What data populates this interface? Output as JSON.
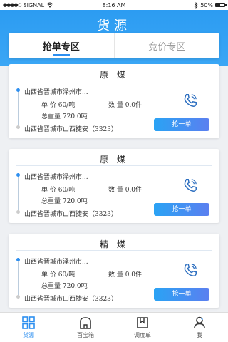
{
  "status_bar": {
    "carrier": "SIGNAL",
    "time": "8:16 AM",
    "battery": "50%"
  },
  "header": {
    "title": "货源"
  },
  "tabs": [
    {
      "label": "抢单专区",
      "active": true
    },
    {
      "label": "竞价专区",
      "active": false
    }
  ],
  "cards": [
    {
      "name": "原 煤",
      "origin": "山西省晋城市泽州市...",
      "unit_price": "单 价 60/吨",
      "quantity": "数 量 0.0件",
      "total_weight": "总重量 720.0吨",
      "destination": "山西省晋城市山西捷安（3323）",
      "button": "抢一单"
    },
    {
      "name": "原 煤",
      "origin": "山西省晋城市泽州市...",
      "unit_price": "单 价 60/吨",
      "quantity": "数 量 0.0件",
      "total_weight": "总重量 720.0吨",
      "destination": "山西省晋城市山西捷安（3323）",
      "button": "抢一单"
    },
    {
      "name": "精 煤",
      "origin": "山西省晋城市泽州市...",
      "unit_price": "单 价 60/吨",
      "quantity": "数 量 0.0件",
      "total_weight": "总重量 720.0吨",
      "destination": "山西省晋城市山西捷安（3323）",
      "button": "抢一单"
    }
  ],
  "nav": [
    {
      "label": "货源",
      "icon": "grid-icon",
      "active": true
    },
    {
      "label": "百宝箱",
      "icon": "toolbox-icon",
      "active": false
    },
    {
      "label": "调度单",
      "icon": "book-icon",
      "active": false
    },
    {
      "label": "我",
      "icon": "person-icon",
      "active": false
    }
  ],
  "colors": {
    "primary": "#2d8ff0",
    "header": "#2c9cf2",
    "button_start": "#2aa3f4",
    "button_end": "#5b7ff0"
  }
}
